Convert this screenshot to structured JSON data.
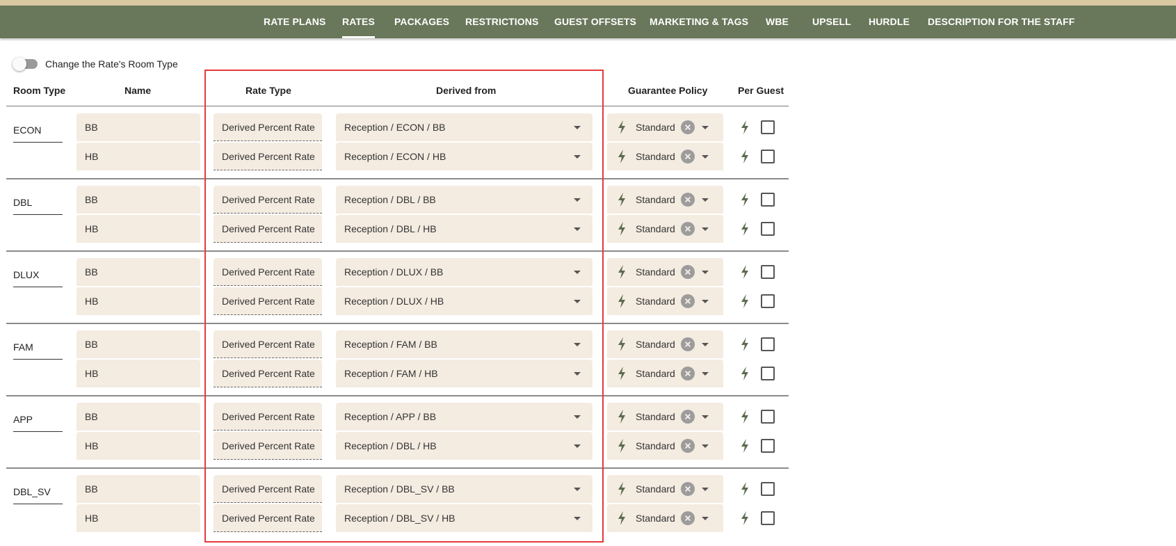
{
  "nav": {
    "tabs": [
      {
        "label": "RATE PLANS",
        "active": false
      },
      {
        "label": "RATES",
        "active": true
      },
      {
        "label": "PACKAGES",
        "active": false
      },
      {
        "label": "RESTRICTIONS",
        "active": false
      },
      {
        "label": "GUEST OFFSETS",
        "active": false
      },
      {
        "label": "MARKETING & TAGS",
        "active": false
      },
      {
        "label": "WBE",
        "active": false
      },
      {
        "label": "UPSELL",
        "active": false
      },
      {
        "label": "HURDLE",
        "active": false
      },
      {
        "label": "DESCRIPTION FOR THE STAFF",
        "active": false
      }
    ]
  },
  "toggle": {
    "label": "Change the Rate's Room Type",
    "on": false
  },
  "columns": {
    "room_type": "Room Type",
    "name": "Name",
    "rate_type": "Rate Type",
    "derived_from": "Derived from",
    "guarantee_policy": "Guarantee Policy",
    "per_guest": "Per Guest"
  },
  "groups": [
    {
      "room_type": "ECON",
      "rows": [
        {
          "name": "BB",
          "rate_type": "Derived Percent Rate",
          "derived_from": "Reception / ECON / BB",
          "guarantee": "Standard",
          "per_guest": false
        },
        {
          "name": "HB",
          "rate_type": "Derived Percent Rate",
          "derived_from": "Reception / ECON / HB",
          "guarantee": "Standard",
          "per_guest": false
        }
      ]
    },
    {
      "room_type": "DBL",
      "rows": [
        {
          "name": "BB",
          "rate_type": "Derived Percent Rate",
          "derived_from": "Reception / DBL / BB",
          "guarantee": "Standard",
          "per_guest": false
        },
        {
          "name": "HB",
          "rate_type": "Derived Percent Rate",
          "derived_from": "Reception / DBL / HB",
          "guarantee": "Standard",
          "per_guest": false
        }
      ]
    },
    {
      "room_type": "DLUX",
      "rows": [
        {
          "name": "BB",
          "rate_type": "Derived Percent Rate",
          "derived_from": "Reception / DLUX / BB",
          "guarantee": "Standard",
          "per_guest": false
        },
        {
          "name": "HB",
          "rate_type": "Derived Percent Rate",
          "derived_from": "Reception / DLUX / HB",
          "guarantee": "Standard",
          "per_guest": false
        }
      ]
    },
    {
      "room_type": "FAM",
      "rows": [
        {
          "name": "BB",
          "rate_type": "Derived Percent Rate",
          "derived_from": "Reception / FAM / BB",
          "guarantee": "Standard",
          "per_guest": false
        },
        {
          "name": "HB",
          "rate_type": "Derived Percent Rate",
          "derived_from": "Reception / FAM / HB",
          "guarantee": "Standard",
          "per_guest": false
        }
      ]
    },
    {
      "room_type": "APP",
      "rows": [
        {
          "name": "BB",
          "rate_type": "Derived Percent Rate",
          "derived_from": "Reception / APP / BB",
          "guarantee": "Standard",
          "per_guest": false
        },
        {
          "name": "HB",
          "rate_type": "Derived Percent Rate",
          "derived_from": "Reception / DBL / HB",
          "guarantee": "Standard",
          "per_guest": false
        }
      ]
    },
    {
      "room_type": "DBL_SV",
      "rows": [
        {
          "name": "BB",
          "rate_type": "Derived Percent Rate",
          "derived_from": "Reception / DBL_SV / BB",
          "guarantee": "Standard",
          "per_guest": false
        },
        {
          "name": "HB",
          "rate_type": "Derived Percent Rate",
          "derived_from": "Reception / DBL_SV / HB",
          "guarantee": "Standard",
          "per_guest": false
        }
      ]
    }
  ],
  "icons": {
    "bolt": "bolt-icon",
    "clear": "clear-circle-icon",
    "dropdown": "chevron-down-icon"
  },
  "colors": {
    "nav_bg": "#69775a",
    "field_bg": "#f4ebe1",
    "highlight": "#e53a3a",
    "bolt": "#5d6b4f"
  }
}
